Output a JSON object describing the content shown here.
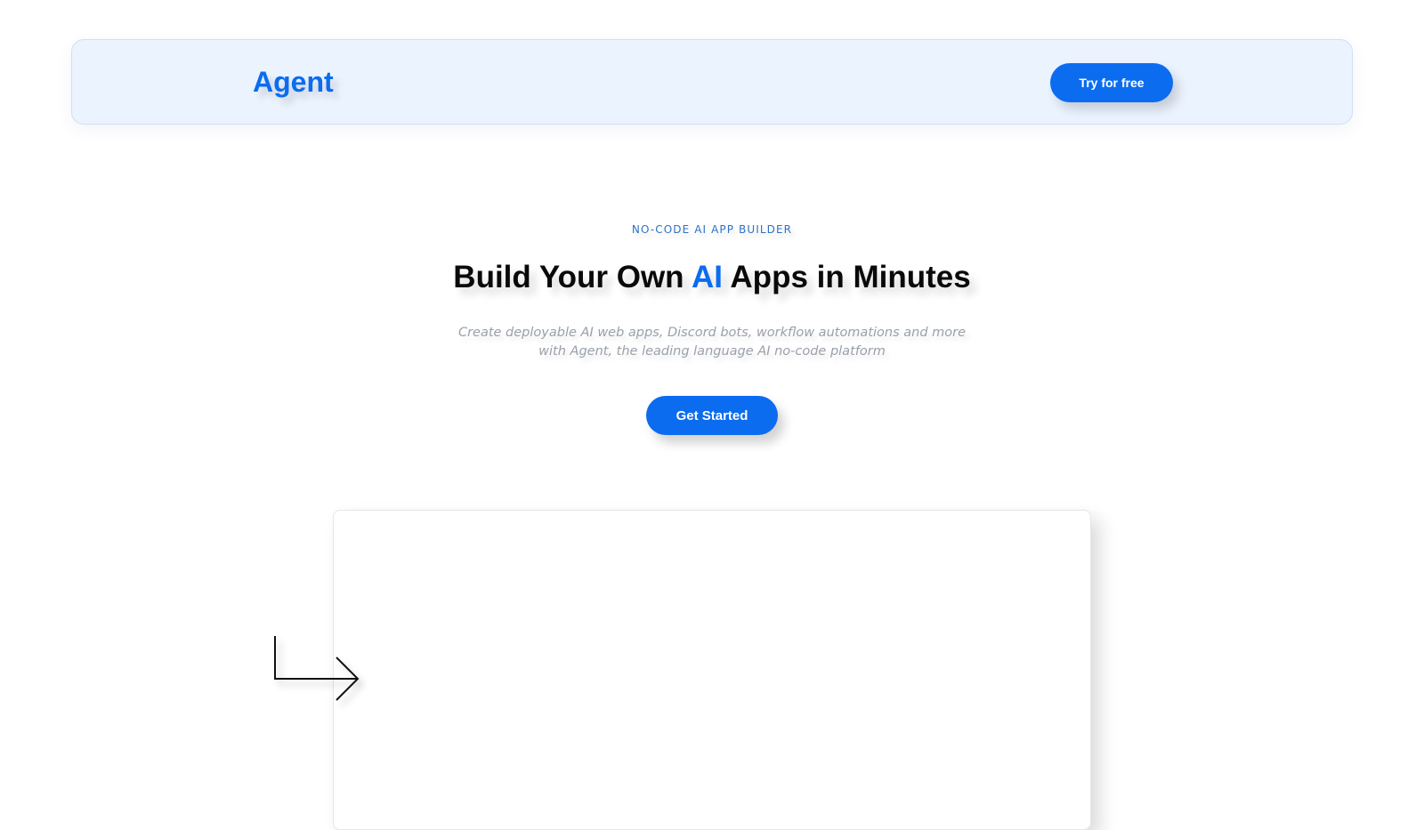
{
  "navbar": {
    "brand": "Agent",
    "try_button_label": "Try for free"
  },
  "hero": {
    "eyebrow": "NO-CODE AI APP BUILDER",
    "headline_before": "Build Your Own ",
    "headline_accent": "AI",
    "headline_after": " Apps in Minutes",
    "subtitle_line1": "Create deployable AI web apps, Discord bots, workflow automations and more",
    "subtitle_line2": "with Agent, the leading language AI no-code platform",
    "cta_label": "Get Started"
  },
  "icons": {
    "arrow": "arrow-down-right-icon"
  },
  "colors": {
    "accent": "#0b6cf0",
    "navbar_background": "#ebf3ff",
    "eyebrow": "#2f72c4",
    "subtitle": "#9aa0aa"
  }
}
